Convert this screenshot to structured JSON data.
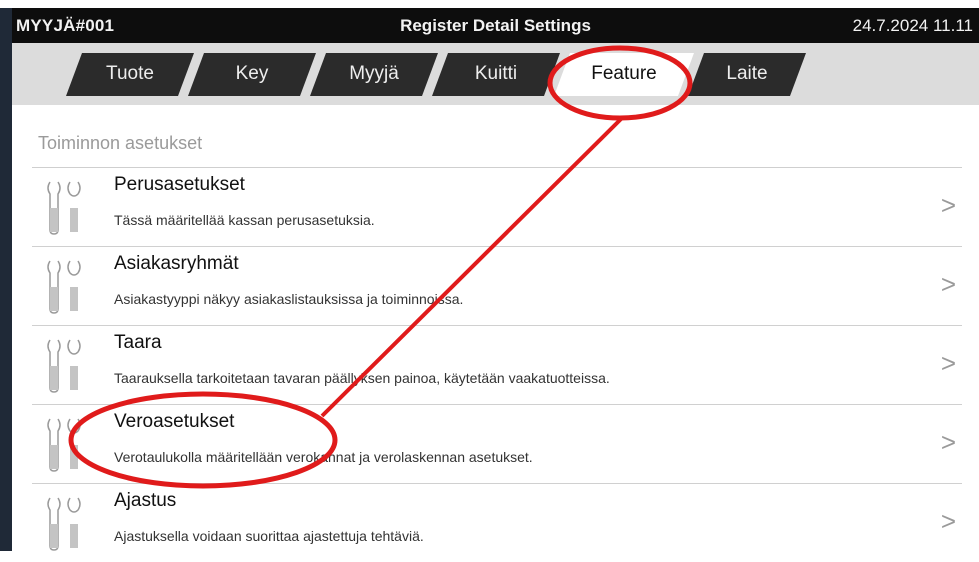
{
  "window": {
    "user": "MYYJÄ#001",
    "title": "Register Detail Settings",
    "datetime": "24.7.2024 11.11"
  },
  "tabs": [
    {
      "label": "Tuote"
    },
    {
      "label": "Key"
    },
    {
      "label": "Myyjä"
    },
    {
      "label": "Kuitti"
    },
    {
      "label": "Feature",
      "active": true
    },
    {
      "label": "Laite"
    }
  ],
  "section": {
    "header": "Toiminnon asetukset"
  },
  "items": [
    {
      "title": "Perusasetukset",
      "desc": "Tässä määritellää kassan perusasetuksia.",
      "icon": "tools-icon"
    },
    {
      "title": "Asiakasryhmät",
      "desc": "Asiakastyyppi näkyy asiakaslistauksissa ja toiminnoissa.",
      "icon": "tools-icon"
    },
    {
      "title": "Taara",
      "desc": "Taarauksella tarkoitetaan tavaran päällyksen painoa, käytetään vaakatuotteissa.",
      "icon": "tools-icon"
    },
    {
      "title": "Veroasetukset",
      "desc": "Verotaulukolla määritellään verokannat ja verolaskennan asetukset.",
      "icon": "tools-icon"
    },
    {
      "title": "Ajastus",
      "desc": "Ajastuksella voidaan suorittaa ajastettuja tehtäviä.",
      "icon": "tools-icon"
    }
  ],
  "chevron": ">",
  "colors": {
    "annotation": "#e01b1b",
    "titlebar": "#0d0d0d",
    "tab": "#2b2b2b",
    "tabbar": "#dcdcdc"
  }
}
